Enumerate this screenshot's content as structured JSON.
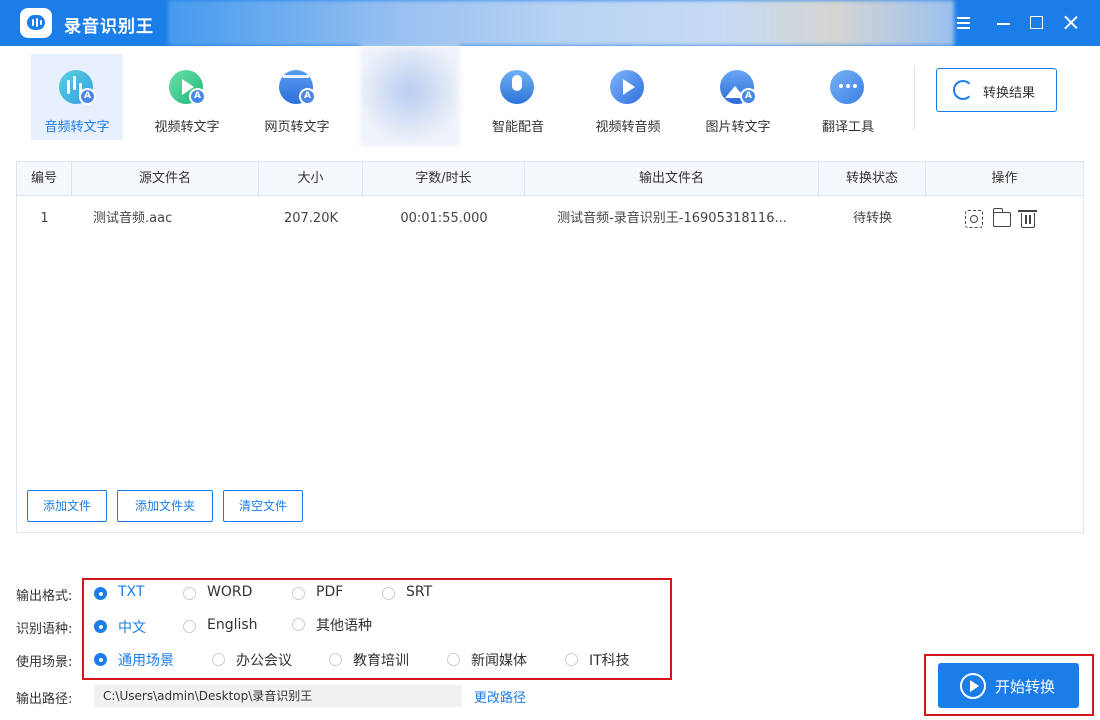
{
  "app": {
    "title": "录音识别王"
  },
  "toolbar": {
    "tools": [
      {
        "label": "音频转文字",
        "icon": "audio-to-text-icon",
        "active": true
      },
      {
        "label": "视频转文字",
        "icon": "video-to-text-icon"
      },
      {
        "label": "网页转文字",
        "icon": "web-to-text-icon"
      },
      {
        "label": "智能配音",
        "icon": "smart-dubbing-icon"
      },
      {
        "label": "视频转音频",
        "icon": "video-to-audio-icon"
      },
      {
        "label": "图片转文字",
        "icon": "image-to-text-icon"
      },
      {
        "label": "翻译工具",
        "icon": "translate-tool-icon"
      }
    ],
    "badge_letter": "A",
    "result_label": "转换结果"
  },
  "table": {
    "headers": [
      "编号",
      "源文件名",
      "大小",
      "字数/时长",
      "输出文件名",
      "转换状态",
      "操作"
    ],
    "rows": [
      {
        "index": "1",
        "source": "测试音频.aac",
        "size": "207.20K",
        "duration": "00:01:55.000",
        "output": "测试音频-录音识别王-16905318116...",
        "status": "待转换"
      }
    ]
  },
  "panel_buttons": {
    "add_file": "添加文件",
    "add_folder": "添加文件夹",
    "clear": "清空文件"
  },
  "settings": {
    "format_label": "输出格式:",
    "formats": [
      "TXT",
      "WORD",
      "PDF",
      "SRT"
    ],
    "language_label": "识别语种:",
    "languages": [
      "中文",
      "English",
      "其他语种"
    ],
    "scene_label": "使用场景:",
    "scenes": [
      "通用场景",
      "办公会议",
      "教育培训",
      "新闻媒体",
      "IT科技"
    ],
    "path_label": "输出路径:",
    "path_value": "C:\\Users\\admin\\Desktop\\录音识别王",
    "change_path": "更改路径"
  },
  "start_label": "开始转换",
  "colors": {
    "primary": "#1b7de8",
    "highlight": "#d7141a"
  }
}
